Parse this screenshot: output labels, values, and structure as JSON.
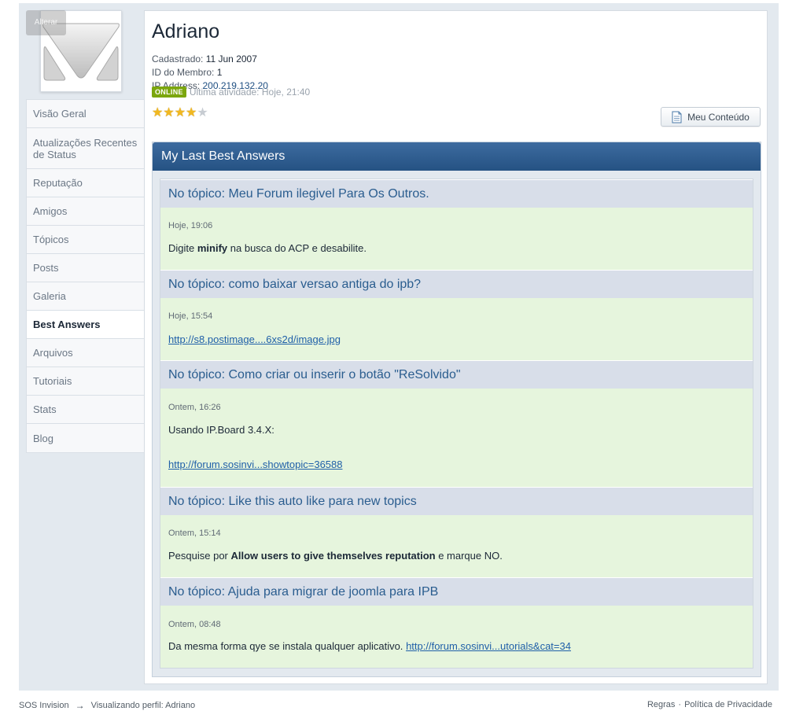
{
  "sidebar": {
    "change_photo_label": "Alterar",
    "tabs": [
      {
        "label": "Visão Geral"
      },
      {
        "label": "Atualizações Recentes de Status"
      },
      {
        "label": "Reputação"
      },
      {
        "label": "Amigos"
      },
      {
        "label": "Tópicos"
      },
      {
        "label": "Posts"
      },
      {
        "label": "Galeria"
      },
      {
        "label": "Best Answers"
      },
      {
        "label": "Arquivos"
      },
      {
        "label": "Tutoriais"
      },
      {
        "label": "Stats"
      },
      {
        "label": "Blog"
      }
    ],
    "active_tab": "Best Answers"
  },
  "profile": {
    "name": "Adriano",
    "registered_label": "Cadastrado:",
    "registered_value": "11 Jun 2007",
    "member_id_label": "ID do Membro:",
    "member_id_value": "1",
    "ip_label": "IP Address:",
    "ip_value": "200.219.132.20",
    "online_badge": "ONLINE",
    "last_activity": "Última atividade: Hoje, 21:40",
    "rating_stars": 4,
    "rating_max": 5,
    "my_content_button": "Meu Conteúdo"
  },
  "best_answers": {
    "title": "My Last Best Answers",
    "items": [
      {
        "topic": "No tópico: Meu Forum ilegivel Para Os Outros.",
        "date": "Hoje, 19:06",
        "text_before": "Digite ",
        "text_bold": "minify",
        "text_after": " na busca do ACP e desabilite."
      },
      {
        "topic": "No tópico: como baixar versao antiga do ipb?",
        "date": "Hoje, 15:54",
        "link": "http://s8.postimage....6xs2d/image.jpg"
      },
      {
        "topic": "No tópico: Como criar ou inserir o botão \"ReSolvido\"",
        "date": "Ontem, 16:26",
        "text": "Usando IP.Board 3.4.X:",
        "link": "http://forum.sosinvi...showtopic=36588"
      },
      {
        "topic": "No tópico: Like this auto like para new topics",
        "date": "Ontem, 15:14",
        "text_before": "Pesquise por ",
        "text_bold": "Allow users to give themselves reputation",
        "text_after": " e marque NO."
      },
      {
        "topic": "No tópico: Ajuda para migrar de joomla para IPB",
        "date": "Ontem, 08:48",
        "text": "Da mesma forma qye se instala qualquer aplicativo.",
        "link": "http://forum.sosinvi...utorials&cat=34"
      }
    ]
  },
  "footer": {
    "site": "SOS Invision",
    "arrow": "→",
    "viewing": "Visualizando perfil: Adriano",
    "rules": "Regras",
    "separator": "·",
    "privacy": "Política de Privacidade"
  },
  "colors": {
    "header_blue": "#255283",
    "topic_bg": "#d8dee9",
    "answer_bg": "#e6f5dd",
    "online_green": "#7ba60d",
    "link_blue": "#1f5fa8"
  }
}
